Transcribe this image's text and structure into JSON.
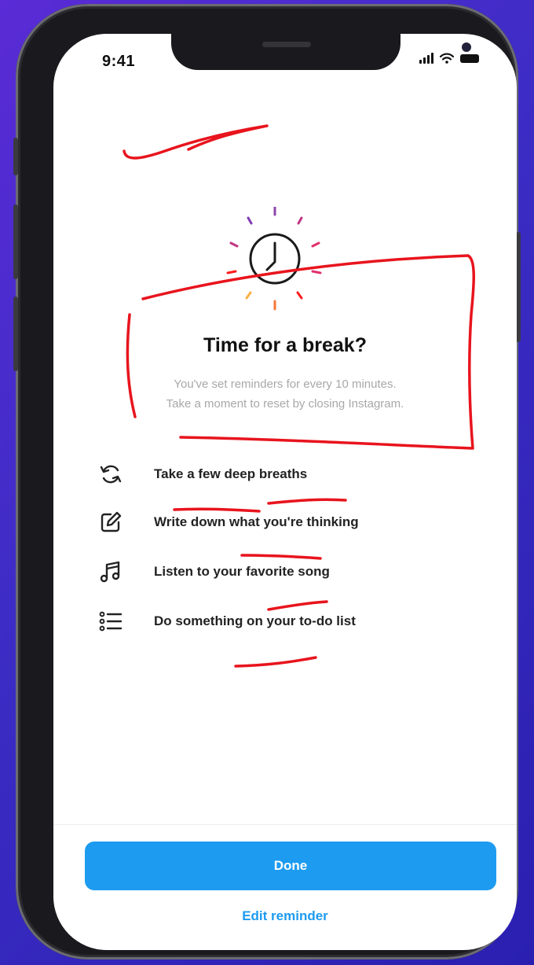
{
  "status_bar": {
    "time": "9:41"
  },
  "icons": {
    "clock": "clock-icon",
    "breath": "refresh-icon",
    "write": "edit-icon",
    "music": "music-note-icon",
    "list": "list-icon"
  },
  "break_prompt": {
    "title": "Time for a break?",
    "subtitle_line1": "You've set reminders for every 10 minutes.",
    "subtitle_line2": "Take a moment to reset by closing Instagram."
  },
  "tips": [
    {
      "label": "Take a few deep breaths"
    },
    {
      "label": "Write down what you're thinking"
    },
    {
      "label": "Listen to your favorite song"
    },
    {
      "label": "Do something on your to-do list"
    }
  ],
  "actions": {
    "done_label": "Done",
    "edit_label": "Edit reminder"
  },
  "colors": {
    "accent": "#1d9bf0",
    "annotation": "#e8141d",
    "background_gradient_start": "#5a2bd6"
  }
}
